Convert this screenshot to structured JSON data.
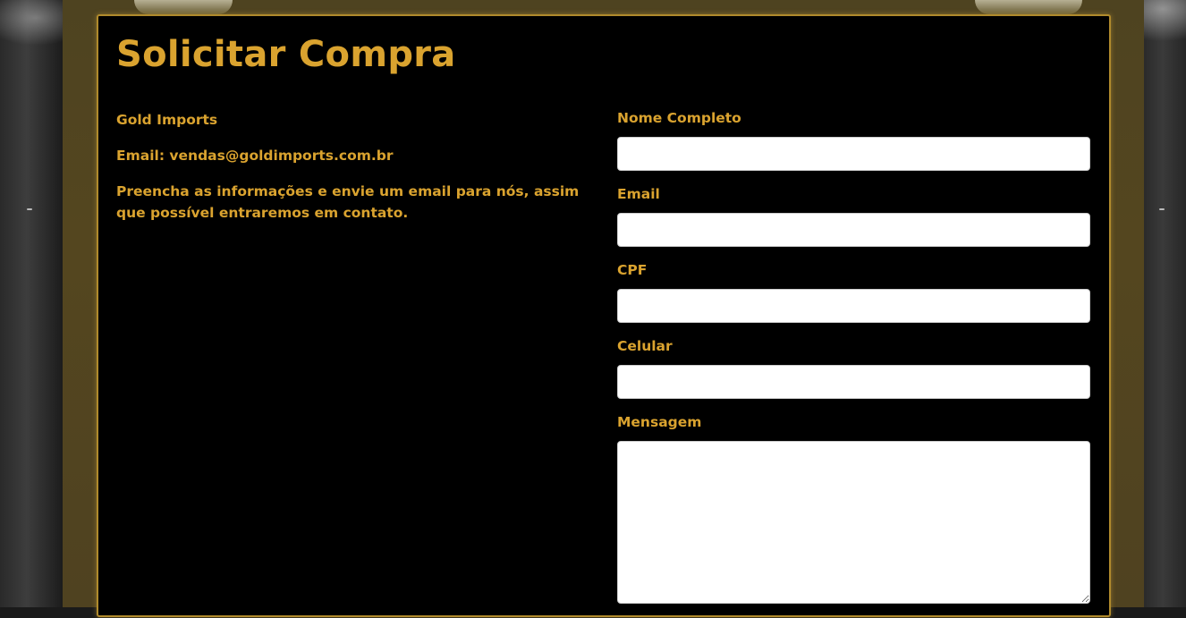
{
  "page": {
    "title": "Solicitar Compra"
  },
  "info": {
    "company": "Gold Imports",
    "email_line": "Email: vendas@goldimports.com.br",
    "instructions": "Preencha as informações e envie um email para nós, assim que possível entraremos em contato."
  },
  "form": {
    "name_label": "Nome Completo",
    "name_value": "",
    "email_label": "Email",
    "email_value": "",
    "cpf_label": "CPF",
    "cpf_value": "",
    "phone_label": "Celular",
    "phone_value": "",
    "message_label": "Mensagem",
    "message_value": ""
  },
  "colors": {
    "accent": "#daa32f",
    "panel_bg": "#000000",
    "frame": "#54461f"
  }
}
